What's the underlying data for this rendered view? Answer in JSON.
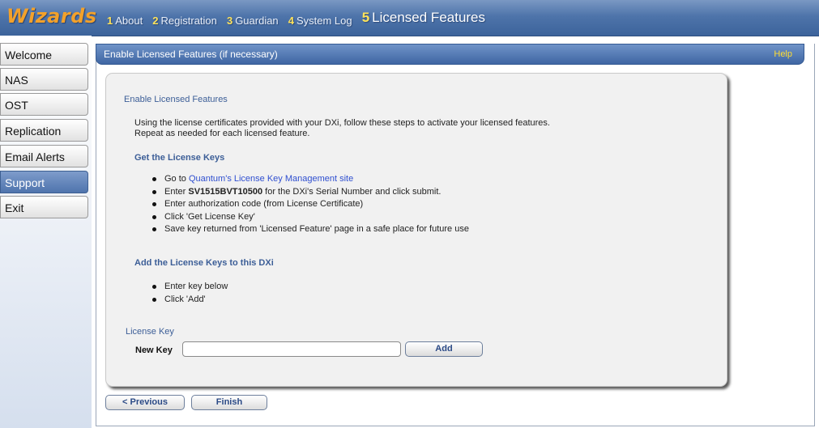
{
  "brand": "Wizards",
  "steps": [
    {
      "num": "1",
      "label": "About"
    },
    {
      "num": "2",
      "label": "Registration"
    },
    {
      "num": "3",
      "label": "Guardian"
    },
    {
      "num": "4",
      "label": "System Log"
    },
    {
      "num": "5",
      "label": "Licensed Features"
    }
  ],
  "sidebar": {
    "items": [
      {
        "label": "Welcome"
      },
      {
        "label": "NAS"
      },
      {
        "label": "OST"
      },
      {
        "label": "Replication"
      },
      {
        "label": "Email Alerts"
      },
      {
        "label": "Support",
        "active": true
      },
      {
        "label": "Exit"
      }
    ]
  },
  "panel": {
    "title": "Enable Licensed Features (if necessary)",
    "help": "Help"
  },
  "content": {
    "heading": "Enable Licensed Features",
    "intro_line1": "Using the license certificates provided with your DXi, follow these steps to activate your licensed features.",
    "intro_line2": "Repeat as needed for each licensed feature.",
    "get_keys_title": "Get the License Keys",
    "get_keys": {
      "go_to_prefix": "Go to ",
      "go_to_link": "Quantum's License Key Management site",
      "enter_prefix": "Enter ",
      "serial": "SV1515BVT10500",
      "enter_suffix": " for the DXi's Serial Number and click submit.",
      "auth": "Enter authorization code (from License Certificate)",
      "click": "Click 'Get License Key'",
      "save": "Save key returned from 'Licensed Feature' page in a safe place for future use"
    },
    "add_keys_title": "Add the License Keys to this DXi",
    "add_keys": [
      "Enter key below",
      "Click 'Add'"
    ],
    "license_key_label": "License Key",
    "new_key_label": "New Key",
    "new_key_value": "",
    "add_button": "Add"
  },
  "footer": {
    "previous": "< Previous",
    "finish": "Finish"
  },
  "colors": {
    "brand": "#f2a12b",
    "accent": "#4e74aa",
    "section_title": "#3c5e97",
    "link": "#2f4fd0",
    "help": "#ffdd33"
  }
}
